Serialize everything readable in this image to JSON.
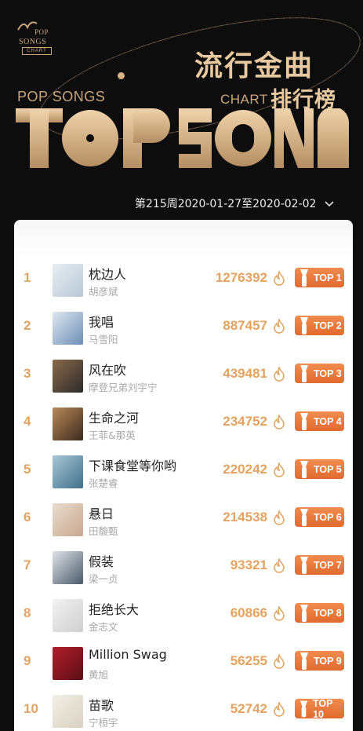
{
  "header": {
    "logo": {
      "line1": "POP",
      "line2": "SONGS",
      "line3": "CHART"
    },
    "title_cn": "流行金曲",
    "subtitle_cn": "排行榜",
    "pop_songs": "POP SONGS",
    "chart": "CHART",
    "big_word": "TOP SONGS"
  },
  "week_selector": {
    "label": "第215周2020-01-27至2020-02-02"
  },
  "colors": {
    "accent": "#e4a35f",
    "badge": "#e86f34",
    "gold": "#e7c89f"
  },
  "entries": [
    {
      "rank": "1",
      "song": "枕边人",
      "artist": "胡彦斌",
      "score": "1276392",
      "badge": "TOP 1"
    },
    {
      "rank": "2",
      "song": "我唱",
      "artist": "马雪阳",
      "score": "887457",
      "badge": "TOP 2"
    },
    {
      "rank": "3",
      "song": "风在吹",
      "artist": "摩登兄弟刘宇宁",
      "score": "439481",
      "badge": "TOP 3"
    },
    {
      "rank": "4",
      "song": "生命之河",
      "artist": "王菲&那英",
      "score": "234752",
      "badge": "TOP 4"
    },
    {
      "rank": "5",
      "song": "下课食堂等你哟",
      "artist": "张楚睿",
      "score": "220242",
      "badge": "TOP 5"
    },
    {
      "rank": "6",
      "song": "悬日",
      "artist": "田馥甄",
      "score": "214538",
      "badge": "TOP 6"
    },
    {
      "rank": "7",
      "song": "假装",
      "artist": "梁一贞",
      "score": "93321",
      "badge": "TOP 7"
    },
    {
      "rank": "8",
      "song": "拒绝长大",
      "artist": "金志文",
      "score": "60866",
      "badge": "TOP 8"
    },
    {
      "rank": "9",
      "song": "Million Swag",
      "artist": "黄旭",
      "score": "56255",
      "badge": "TOP 9"
    },
    {
      "rank": "10",
      "song": "苗歌",
      "artist": "宁桓宇",
      "score": "52742",
      "badge": "TOP 10"
    }
  ]
}
